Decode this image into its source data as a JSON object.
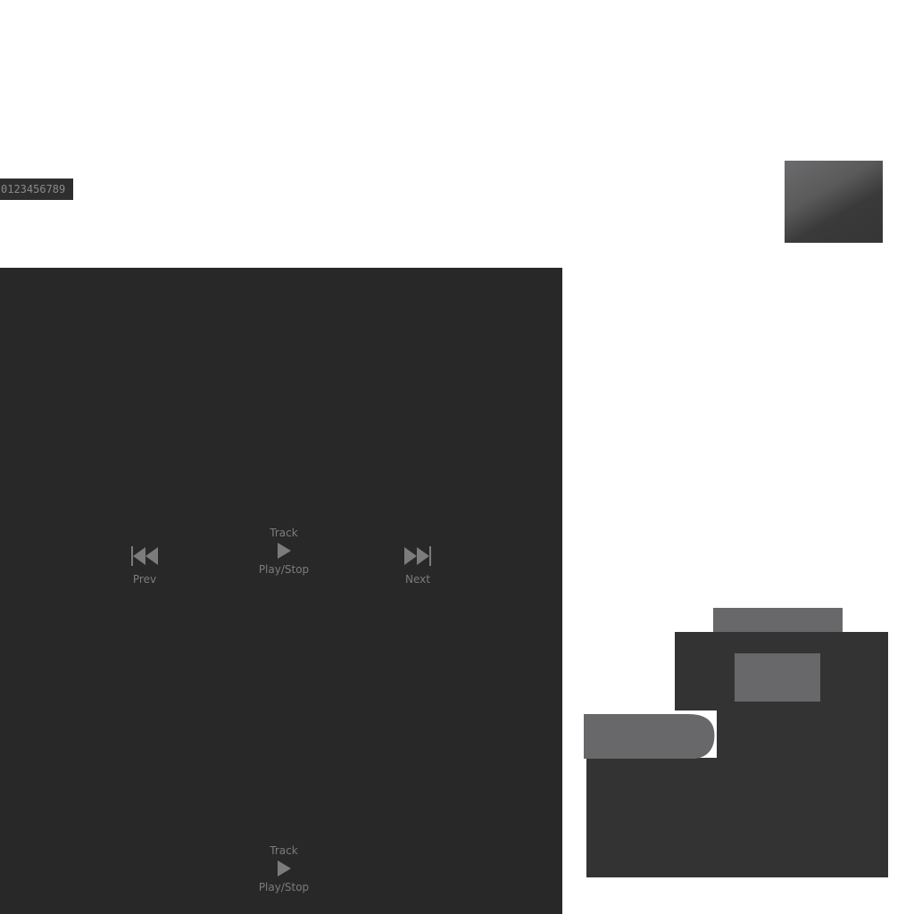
{
  "digits": {
    "text": "0123456789"
  },
  "player": {
    "prev_label": "Prev",
    "next_label": "Next",
    "track_label": "Track",
    "play_stop_label": "Play/Stop",
    "track_label_2": "Track",
    "play_stop_label_2": "Play/Stop"
  },
  "colors": {
    "panel_bg": "#282828",
    "icon": "#7c7c7c",
    "shape_dark": "#333333",
    "shape_light": "#68686b"
  },
  "icons": {
    "prev": "skip-previous-icon",
    "next": "skip-next-icon",
    "play": "play-icon"
  }
}
